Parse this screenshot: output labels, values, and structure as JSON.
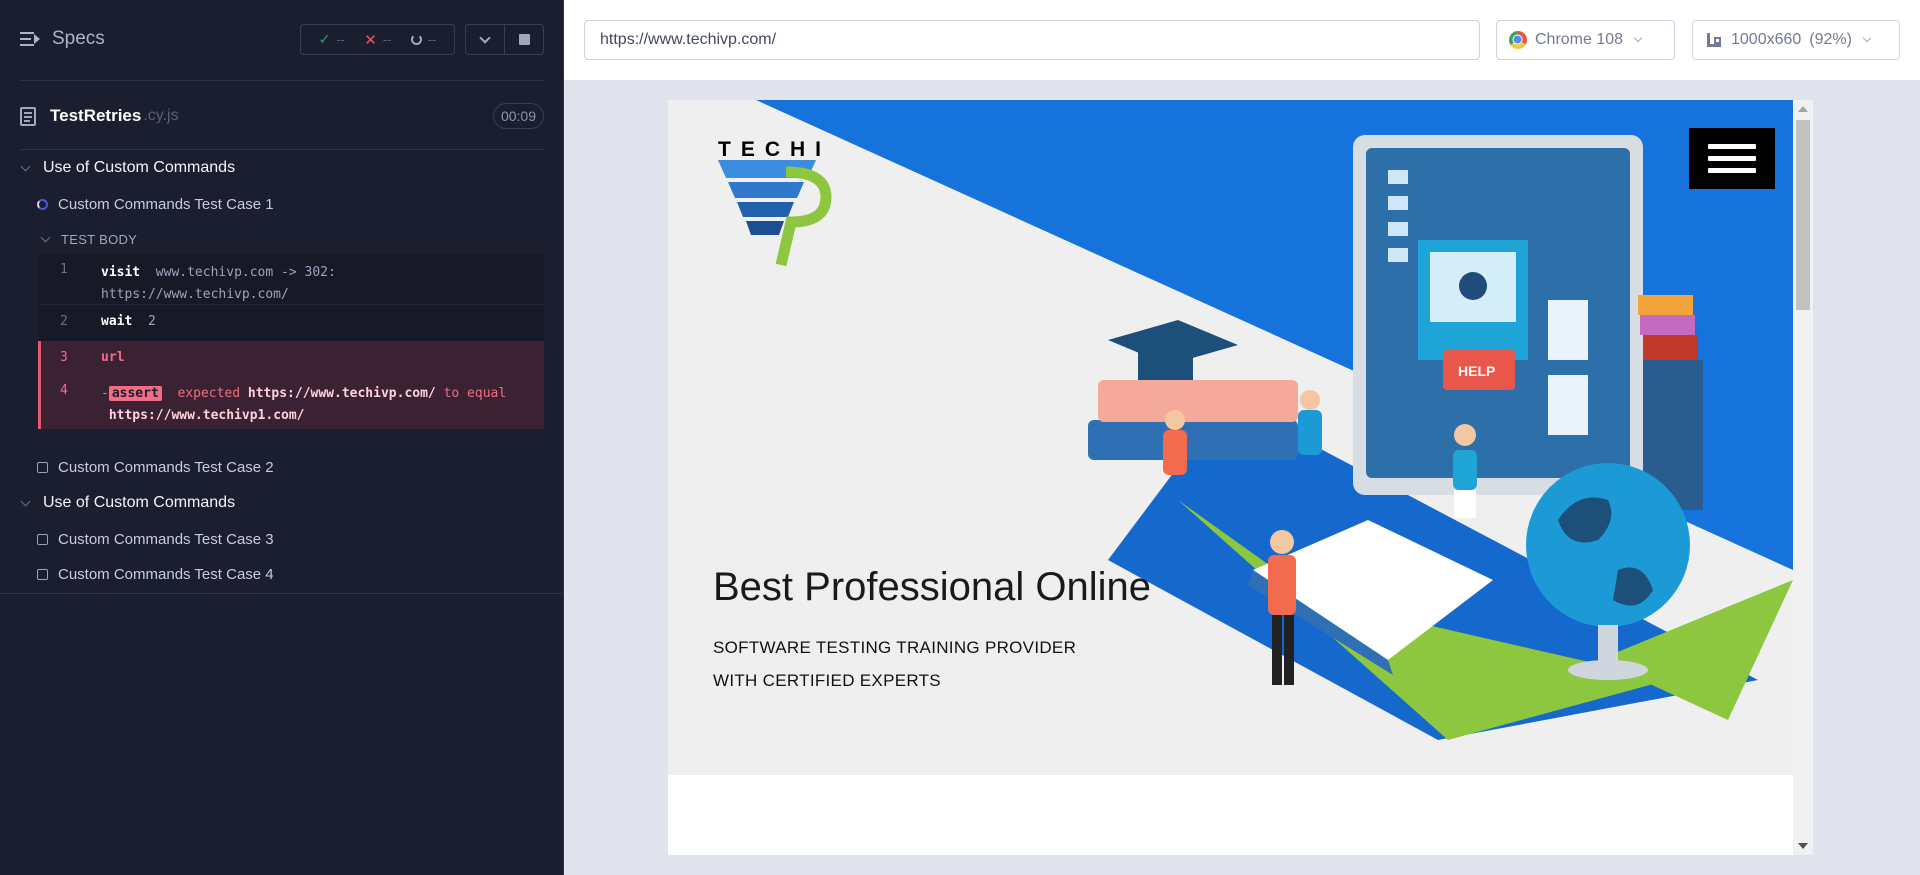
{
  "reporter": {
    "specs_label": "Specs",
    "stats": {
      "passed": "--",
      "failed": "--",
      "pending": "--"
    },
    "spec": {
      "name": "TestRetries",
      "ext": ".cy.js",
      "duration": "00:09"
    },
    "suite1": {
      "title": "Use of Custom Commands",
      "test1": "Custom Commands Test Case 1",
      "body_label": "TEST BODY",
      "commands": [
        {
          "num": "1",
          "name": "visit",
          "msg_line1": "www.techivp.com -> 302:",
          "msg_line2": "https://www.techivp.com/"
        },
        {
          "num": "2",
          "name": "wait",
          "msg": "2"
        },
        {
          "num": "3",
          "name": "url"
        },
        {
          "num": "4",
          "prefix": "-",
          "badge": "assert",
          "w1": "expected",
          "v1": "https://www.techivp.com/",
          "w2": "to equal",
          "v2": "https://www.techivp1.com/"
        }
      ],
      "test2": "Custom Commands Test Case 2"
    },
    "suite2": {
      "title": "Use of Custom Commands",
      "test3": "Custom Commands Test Case 3",
      "test4": "Custom Commands Test Case 4"
    }
  },
  "aut": {
    "url": "https://www.techivp.com/",
    "browser": "Chrome 108",
    "viewport": "1000x660",
    "scale": "(92%)"
  },
  "site": {
    "logo_text": "TECHI",
    "hero_title": "Best Professional Online",
    "hero_sub_line1": "SOFTWARE TESTING TRAINING PROVIDER",
    "hero_sub_line2": "WITH CERTIFIED EXPERTS",
    "help_text": "HELP"
  },
  "colors": {
    "reporter_bg": "#1b1e2e",
    "error_red": "#e45770",
    "pass_green": "#1fa971",
    "site_blue": "#1773dc",
    "site_green": "#8dc63f"
  }
}
